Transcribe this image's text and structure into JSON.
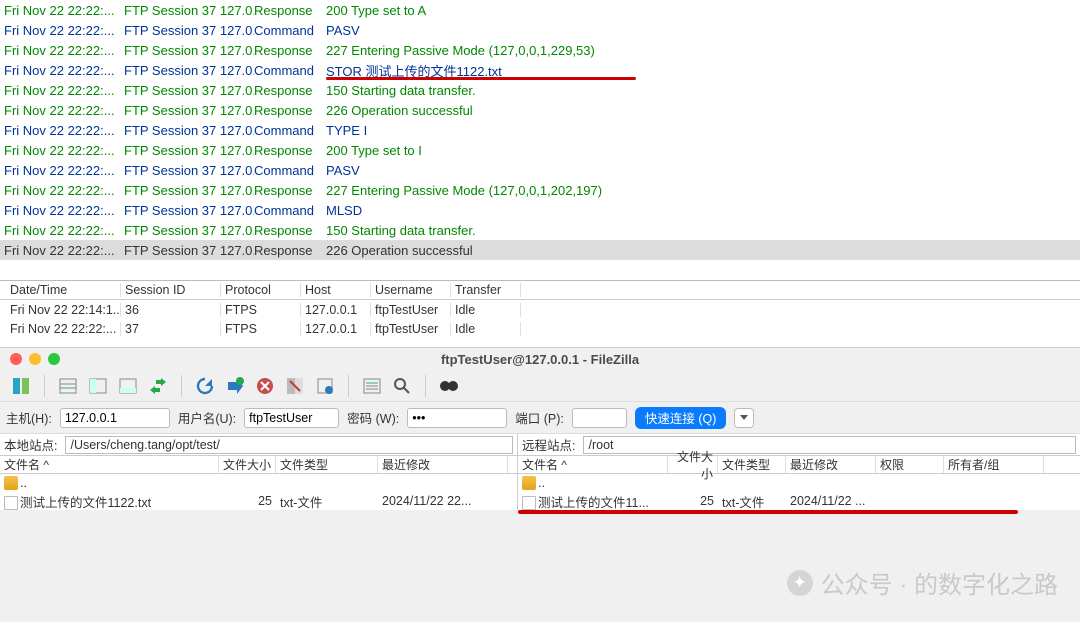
{
  "log": {
    "date_col_prefix": "Fri Nov 22 22:22:...",
    "session_col": "FTP Session 37 127.0....",
    "rows": [
      {
        "type": "Response",
        "msg": "200 Type set to A",
        "cls": "green"
      },
      {
        "type": "Command",
        "msg": "PASV",
        "cls": "blue"
      },
      {
        "type": "Response",
        "msg": "227 Entering Passive Mode (127,0,0,1,229,53)",
        "cls": "green"
      },
      {
        "type": "Command",
        "msg": "STOR 测试上传的文件1122.txt",
        "cls": "blue",
        "ul": "a"
      },
      {
        "type": "Response",
        "msg": "150 Starting data transfer.",
        "cls": "green"
      },
      {
        "type": "Response",
        "msg": "226 Operation successful",
        "cls": "green"
      },
      {
        "type": "Command",
        "msg": "TYPE I",
        "cls": "blue"
      },
      {
        "type": "Response",
        "msg": "200 Type set to I",
        "cls": "green"
      },
      {
        "type": "Command",
        "msg": "PASV",
        "cls": "blue"
      },
      {
        "type": "Response",
        "msg": "227 Entering Passive Mode (127,0,0,1,202,197)",
        "cls": "green"
      },
      {
        "type": "Command",
        "msg": "MLSD",
        "cls": "blue"
      },
      {
        "type": "Response",
        "msg": "150 Starting data transfer.",
        "cls": "green"
      },
      {
        "type": "Response",
        "msg": "226 Operation successful",
        "cls": "sel"
      }
    ]
  },
  "sessions": {
    "headers": {
      "dt": "Date/Time",
      "sid": "Session ID",
      "proto": "Protocol",
      "host": "Host",
      "user": "Username",
      "tx": "Transfer"
    },
    "rows": [
      {
        "dt": "Fri Nov 22 22:14:1...",
        "sid": "36",
        "proto": "FTPS",
        "host": "127.0.0.1",
        "user": "ftpTestUser",
        "tx": "Idle"
      },
      {
        "dt": "Fri Nov 22 22:22:...",
        "sid": "37",
        "proto": "FTPS",
        "host": "127.0.0.1",
        "user": "ftpTestUser",
        "tx": "Idle"
      }
    ]
  },
  "filezilla": {
    "title": "ftpTestUser@127.0.0.1 - FileZilla",
    "quickconnect": {
      "host_label": "主机(H):",
      "host_val": "127.0.0.1",
      "user_label": "用户名(U):",
      "user_val": "ftpTestUser",
      "pass_label": "密码 (W):",
      "pass_val": "•••",
      "port_label": "端口 (P):",
      "port_val": "",
      "button": "快速连接 (Q)"
    },
    "local": {
      "label": "本地站点:",
      "path": "/Users/cheng.tang/opt/test/"
    },
    "remote": {
      "label": "远程站点:",
      "path": "/root"
    },
    "list_headers": {
      "name": "文件名 ^",
      "size": "文件大小",
      "type": "文件类型",
      "mod": "最近修改",
      "perm": "权限",
      "owner": "所有者/组"
    },
    "local_rows": [
      {
        "kind": "up",
        "name": ".."
      },
      {
        "kind": "file",
        "name": "测试上传的文件1122.txt",
        "size": "25",
        "type": "txt-文件",
        "mod": "2024/11/22 22..."
      }
    ],
    "remote_rows": [
      {
        "kind": "up",
        "name": ".."
      },
      {
        "kind": "file",
        "name": "测试上传的文件11...",
        "size": "25",
        "type": "txt-文件",
        "mod": "2024/11/22 ..."
      }
    ]
  },
  "watermark": "公众号 · 的数字化之路"
}
